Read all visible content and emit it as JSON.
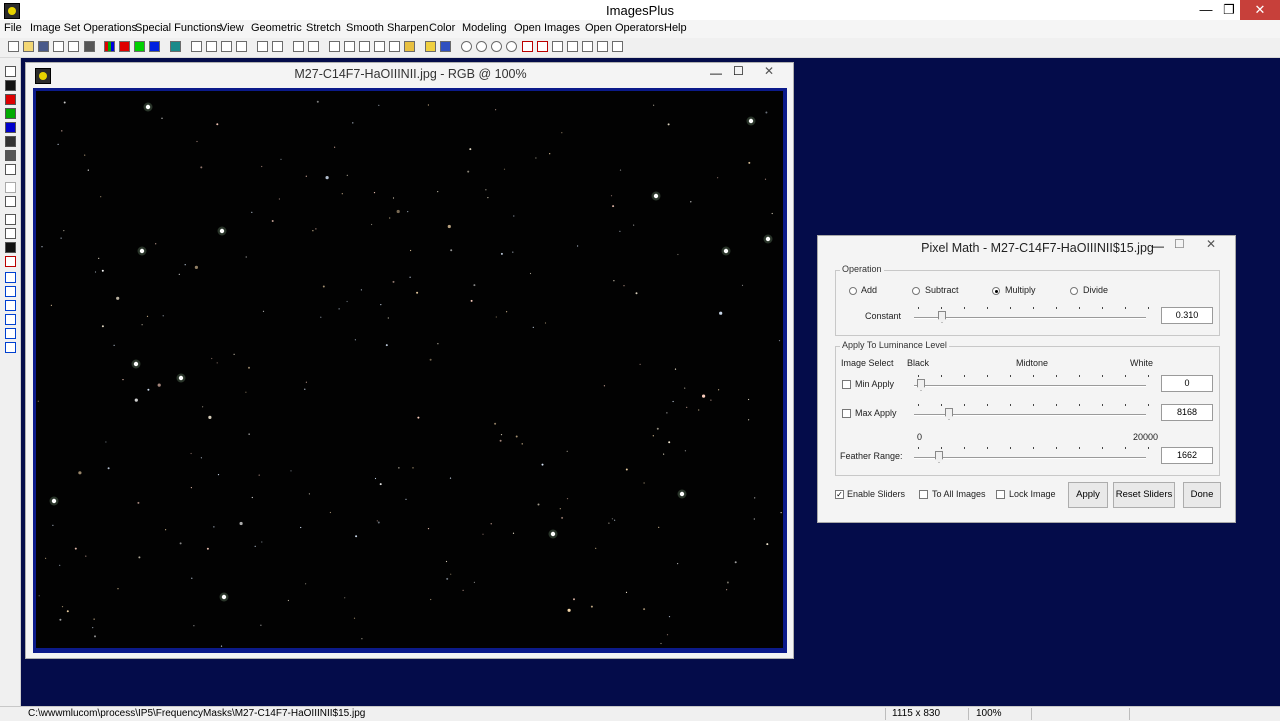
{
  "app": {
    "title": "ImagesPlus"
  },
  "menu": [
    "File",
    "Image Set Operations",
    "Special Functions",
    "View",
    "Geometric",
    "Stretch",
    "Smooth Sharpen",
    "Color",
    "Modeling",
    "Open Images",
    "Open Operators",
    "Help"
  ],
  "image_window": {
    "title": "M27-C14F7-HaOIIINII.jpg - RGB @ 100%"
  },
  "pixel_math": {
    "title": "Pixel Math - M27-C14F7-HaOIIINII$15.jpg",
    "operation": {
      "group_label": "Operation",
      "options": [
        "Add",
        "Subtract",
        "Multiply",
        "Divide"
      ],
      "selected": "Multiply",
      "constant_label": "Constant",
      "constant_value": "0.310",
      "constant_fraction": 0.12
    },
    "luminance": {
      "group_label": "Apply To Luminance Level",
      "image_select": "Image Select",
      "black": "Black",
      "midtone": "Midtone",
      "white": "White",
      "min_label": "Min Apply",
      "min_value": "0",
      "min_checked": false,
      "max_label": "Max Apply",
      "max_value": "8168",
      "max_checked": false,
      "range_min": "0",
      "range_max": "20000",
      "feather_label": "Feather Range:",
      "feather_value": "1662"
    },
    "enable_sliders": "Enable Sliders",
    "enable_checked": true,
    "to_all_images": "To All Images",
    "lock_image": "Lock Image",
    "apply": "Apply",
    "reset_sliders": "Reset Sliders",
    "done": "Done"
  },
  "status": {
    "path": "C:\\wwwmlucom\\process\\IP5\\FrequencyMasks\\M27-C14F7-HaOIIINII$15.jpg",
    "dimensions": "1115 x 830",
    "zoom": "100%"
  },
  "colors": {
    "workspace": "#040c4a",
    "image_frame": "#0b1a8a",
    "close": "#c7403a"
  }
}
